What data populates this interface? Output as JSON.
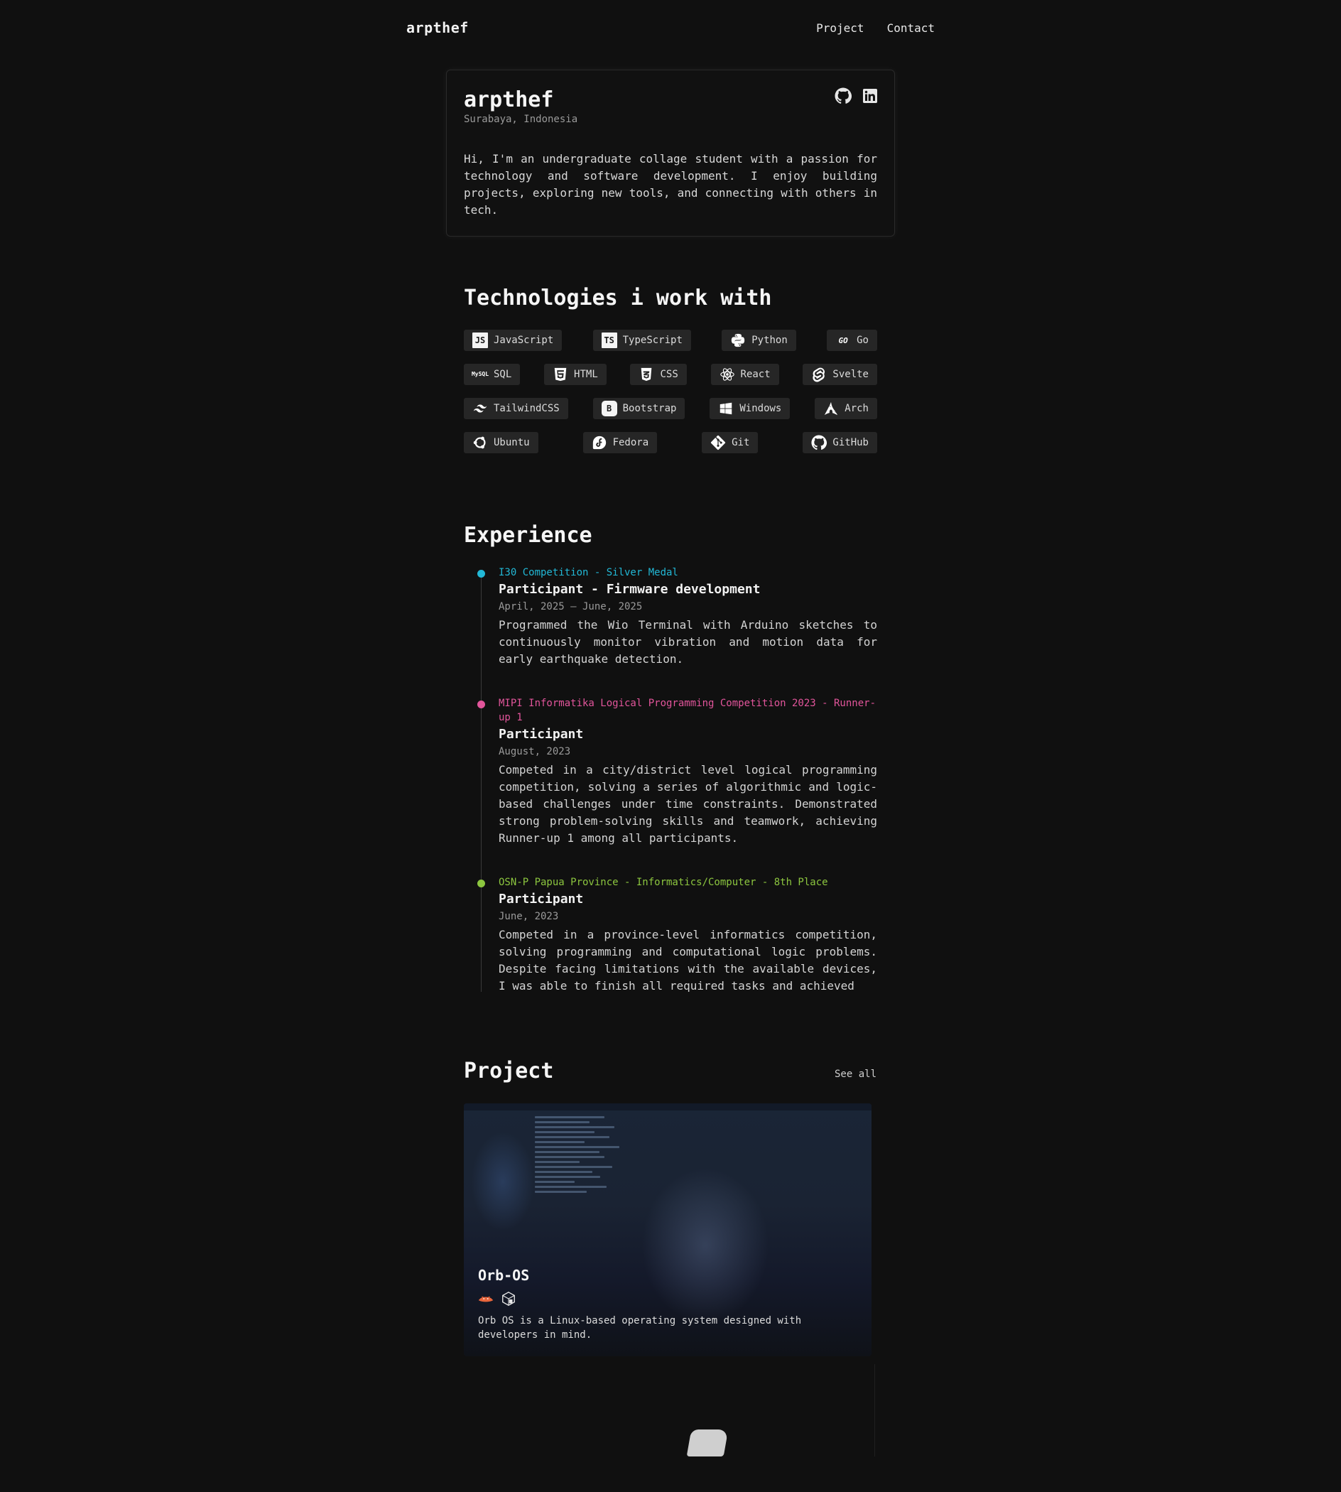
{
  "nav": {
    "brand": "arpthef",
    "links": [
      "Project",
      "Contact"
    ]
  },
  "profile": {
    "name": "arpthef",
    "location": "Surabaya, Indonesia",
    "bio": "Hi, I'm an undergraduate collage student with a passion for technology and software development. I enjoy building projects, exploring new tools, and connecting with others in tech.",
    "socials": [
      "github-icon",
      "linkedin-icon"
    ]
  },
  "technologies": {
    "title": "Technologies i work with",
    "rows": [
      [
        "JavaScript",
        "TypeScript",
        "Python",
        "Go"
      ],
      [
        "SQL",
        "HTML",
        "CSS",
        "React",
        "Svelte"
      ],
      [
        "TailwindCSS",
        "Bootstrap",
        "Windows",
        "Arch"
      ],
      [
        "Ubuntu",
        "Fedora",
        "Git",
        "GitHub"
      ]
    ]
  },
  "experience": {
    "title": "Experience",
    "items": [
      {
        "org": "I30 Competition - Silver Medal",
        "role": "Participant - Firmware development",
        "date": "April, 2025 — June, 2025",
        "desc": "Programmed the Wio Terminal with Arduino sketches to continuously monitor vibration and motion data for early earthquake detection.",
        "color": "#22b8d6"
      },
      {
        "org": "MIPI Informatika Logical Programming Competition 2023 - Runner-up 1",
        "role": "Participant",
        "date": "August, 2023",
        "desc": "Competed in a city/district level logical programming competition, solving a series of algorithmic and logic-based challenges under time constraints. Demonstrated strong problem-solving skills and teamwork, achieving Runner-up 1 among all participants.",
        "color": "#e2559b"
      },
      {
        "org": "OSN-P Papua Province - Informatics/Computer - 8th Place",
        "role": "Participant",
        "date": "June, 2023",
        "desc": "Competed in a province-level informatics competition, solving programming and computational logic problems. Despite facing limitations with the available devices, I was able to finish all required tasks and achieved",
        "color": "#8cc63f"
      }
    ]
  },
  "projects": {
    "title": "Project",
    "see_all": "See all",
    "items": [
      {
        "name": "Orb-OS",
        "desc": "Orb OS is a Linux-based operating system designed with developers in mind.",
        "icons": [
          "rust-icon",
          "package-icon"
        ]
      }
    ]
  }
}
